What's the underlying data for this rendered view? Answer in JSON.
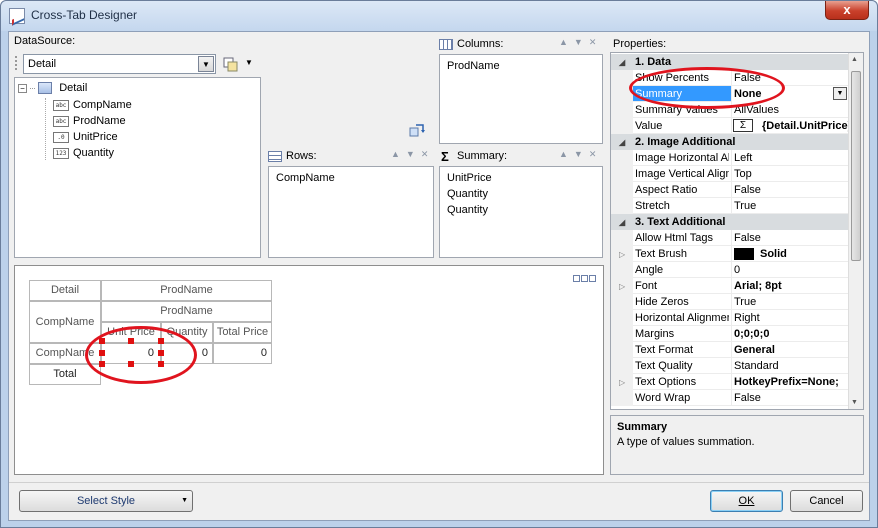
{
  "window": {
    "title": "Cross-Tab Designer",
    "close_glyph": "x"
  },
  "datasource": {
    "label": "DataSource:",
    "selected": "Detail",
    "tree": {
      "root": "Detail",
      "fields": [
        {
          "type_badge": "abc",
          "name": "CompName"
        },
        {
          "type_badge": "abc",
          "name": "ProdName"
        },
        {
          "type_badge": ".0",
          "name": "UnitPrice"
        },
        {
          "type_badge": "123",
          "name": "Quantity"
        }
      ]
    }
  },
  "columns": {
    "label": "Columns:",
    "items": [
      "ProdName"
    ]
  },
  "rows": {
    "label": "Rows:",
    "items": [
      "CompName"
    ]
  },
  "summary": {
    "label": "Summary:",
    "items": [
      "UnitPrice",
      "Quantity",
      "Quantity"
    ]
  },
  "preview": {
    "detail": "Detail",
    "prodname_top": "ProdName",
    "compname_header": "CompName",
    "prodname_sub": "ProdName",
    "col_unit_price": "Unit Price",
    "col_quantity": "Quantity",
    "col_total_price": "Total Price",
    "compname_row": "CompName",
    "zero1": "0",
    "zero2": "0",
    "zero3": "0",
    "total": "Total"
  },
  "properties": {
    "label": "Properties:",
    "categories": [
      {
        "title": "1. Data",
        "rows": [
          {
            "name": "Show Percents",
            "value": "False",
            "bold": false
          },
          {
            "name": "Summary",
            "value": "None",
            "bold": true,
            "selected": true
          },
          {
            "name": "Summary Values",
            "value": "AllValues",
            "bold": false
          },
          {
            "name": "Value",
            "value": "{Detail.UnitPrice}",
            "bold": true
          }
        ]
      },
      {
        "title": "2. Image  Additional",
        "rows": [
          {
            "name": "Image Horizontal Alignment",
            "value": "Left",
            "bold": false
          },
          {
            "name": "Image Vertical Alignment",
            "value": "Top",
            "bold": false
          },
          {
            "name": "Aspect Ratio",
            "value": "False",
            "bold": false
          },
          {
            "name": "Stretch",
            "value": "True",
            "bold": false
          }
        ]
      },
      {
        "title": "3. Text  Additional",
        "rows": [
          {
            "name": "Allow Html Tags",
            "value": "False",
            "bold": false
          },
          {
            "name": "Text Brush",
            "value": "Solid",
            "bold": true,
            "expandable": true,
            "swatch": "#000000"
          },
          {
            "name": "Angle",
            "value": "0",
            "bold": false
          },
          {
            "name": "Font",
            "value": "Arial; 8pt",
            "bold": true,
            "expandable": true
          },
          {
            "name": "Hide Zeros",
            "value": "True",
            "bold": false
          },
          {
            "name": "Horizontal Alignment",
            "value": "Right",
            "bold": false
          },
          {
            "name": "Margins",
            "value": "0;0;0;0",
            "bold": true
          },
          {
            "name": "Text Format",
            "value": "General",
            "bold": true
          },
          {
            "name": "Text Quality",
            "value": "Standard",
            "bold": false
          },
          {
            "name": "Text Options",
            "value": "HotkeyPrefix=None;",
            "bold": true,
            "expandable": true
          },
          {
            "name": "Word Wrap",
            "value": "False",
            "bold": false
          }
        ]
      }
    ],
    "description": {
      "title": "Summary",
      "text": "A type of values summation."
    }
  },
  "footer": {
    "select_style": "Select Style",
    "ok": "OK",
    "cancel": "Cancel"
  },
  "colors": {
    "highlight": "#e0141e",
    "selection": "#3399ff"
  }
}
